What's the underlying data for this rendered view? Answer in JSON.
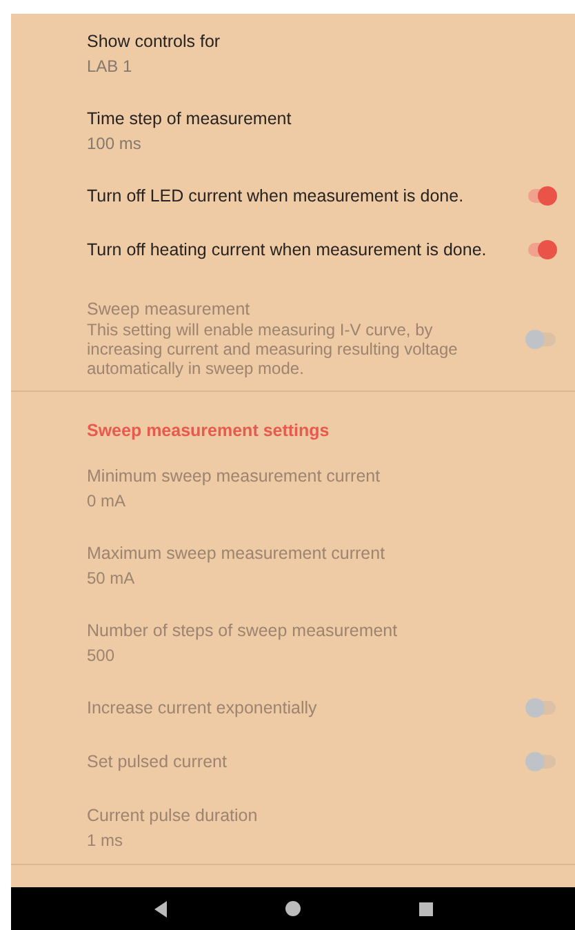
{
  "settings": [
    {
      "kind": "preference",
      "title": "Show controls for",
      "summary": "LAB 1",
      "enabled": true
    },
    {
      "kind": "preference",
      "title": "Time step of measurement",
      "summary": "100 ms",
      "enabled": true
    },
    {
      "kind": "switch",
      "title": "Turn off LED current when measurement is done.",
      "on": true,
      "enabled": true
    },
    {
      "kind": "switch",
      "title": "Turn off heating current when measurement is done.",
      "on": true,
      "enabled": true
    },
    {
      "kind": "switch",
      "title": "Sweep measurement",
      "summary": "This setting will enable measuring I-V curve, by increasing current and measuring resulting voltage automatically in sweep mode.",
      "on": false,
      "enabled": false
    },
    {
      "kind": "category",
      "title": "Sweep measurement settings"
    },
    {
      "kind": "preference",
      "title": "Minimum sweep measurement current",
      "summary": "0 mA",
      "enabled": false
    },
    {
      "kind": "preference",
      "title": "Maximum sweep measurement current",
      "summary": "50 mA",
      "enabled": false
    },
    {
      "kind": "preference",
      "title": "Number of steps of sweep measurement",
      "summary": "500",
      "enabled": false
    },
    {
      "kind": "switch",
      "title": "Increase current exponentially",
      "on": false,
      "enabled": false
    },
    {
      "kind": "switch",
      "title": "Set pulsed current",
      "on": false,
      "enabled": false
    },
    {
      "kind": "preference",
      "title": "Current pulse duration",
      "summary": "1 ms",
      "enabled": false
    }
  ],
  "nav_bar": {
    "buttons": [
      {
        "kind": "back"
      },
      {
        "kind": "home"
      },
      {
        "kind": "recents"
      }
    ]
  }
}
